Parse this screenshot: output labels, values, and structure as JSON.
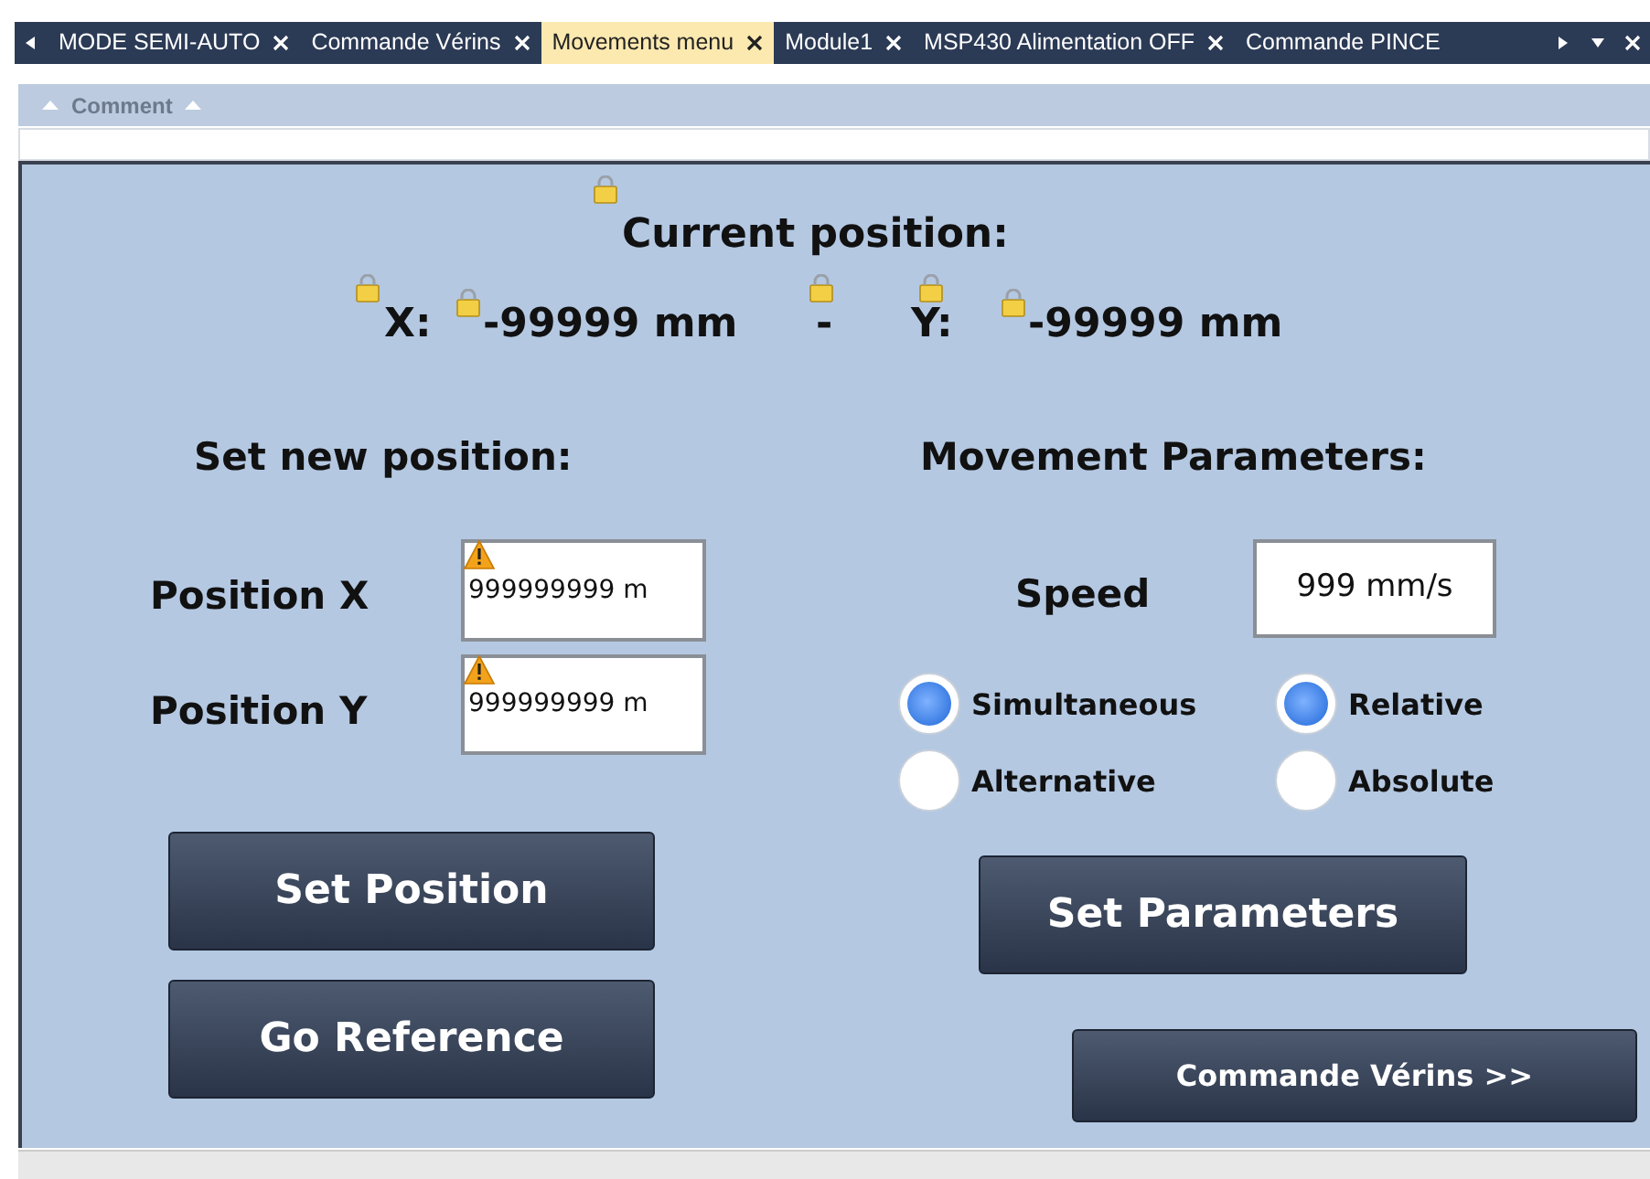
{
  "tabs": [
    {
      "label": "MODE SEMI-AUTO",
      "selected": false
    },
    {
      "label": "Commande Vérins",
      "selected": false
    },
    {
      "label": "Movements menu",
      "selected": true
    },
    {
      "label": "Module1",
      "selected": false
    },
    {
      "label": "MSP430 Alimentation OFF",
      "selected": false
    },
    {
      "label": "Commande PINCE",
      "selected": false
    }
  ],
  "comment_bar": {
    "label": "Comment"
  },
  "screen": {
    "title": "Current position:",
    "current": {
      "x_label": "X:",
      "x_value": "-99999 mm",
      "separator": "-",
      "y_label": "Y:",
      "y_value": "-99999 mm"
    },
    "set_position": {
      "heading": "Set new position:",
      "fields": [
        {
          "label": "Position X",
          "value": "999999999 m"
        },
        {
          "label": "Position Y",
          "value": "999999999 m"
        }
      ]
    },
    "parameters": {
      "heading": "Movement Parameters:",
      "speed_label": "Speed",
      "speed_value": "999 mm/s",
      "mode_options": [
        {
          "label": "Simultaneous",
          "selected": true
        },
        {
          "label": "Alternative",
          "selected": false
        }
      ],
      "reference_options": [
        {
          "label": "Relative",
          "selected": true
        },
        {
          "label": "Absolute",
          "selected": false
        }
      ]
    },
    "buttons": [
      {
        "label": "Set Position",
        "kind": "large"
      },
      {
        "label": "Go Reference",
        "kind": "large"
      },
      {
        "label": "Set Parameters",
        "kind": "large"
      },
      {
        "label": "Commande Vérins >>",
        "kind": "small"
      }
    ]
  }
}
